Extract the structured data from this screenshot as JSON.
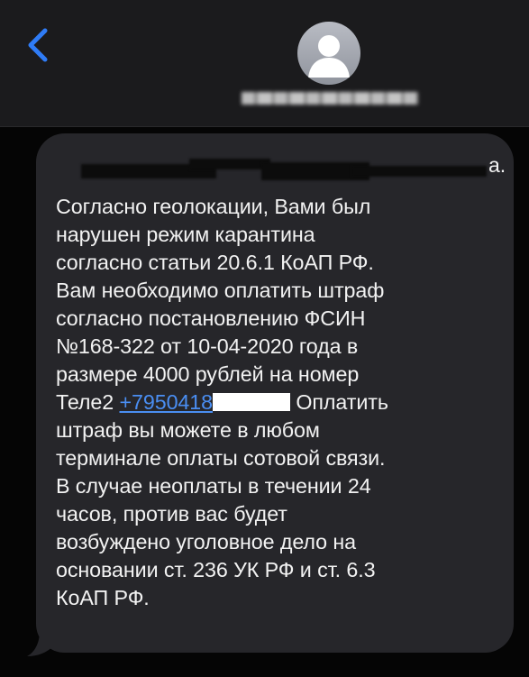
{
  "header": {
    "back_icon": "chevron-left-icon",
    "avatar_icon": "person-icon",
    "contact_name": ""
  },
  "message": {
    "sender_line_visible": "а.",
    "body_part1": "Согласно геолокации, Вами был\nнарушен режим карантина\nсогласно статьи 20.6.1 КоАП РФ.\nВам необходимо оплатить штраф\nсогласно постановлению ФСИН\n№168-322 от 10-04-2020 года в\nразмере 4000 рублей на номер\nТеле2 ",
    "phone_link": "+7950418",
    "body_part2": " Оплатить\nштраф вы можете в любом\nтерминале оплаты сотовой связи.\nВ случае неоплаты в течении 24\nчасов, против вас будет\nвозбуждено уголовное дело на\nосновании ст. 236 УК РФ и ст. 6.3\nКоАП РФ."
  },
  "colors": {
    "bubble": "#26262a",
    "header": "#1b1b1d",
    "link": "#4a8ef2",
    "text": "#f2f2f2"
  }
}
